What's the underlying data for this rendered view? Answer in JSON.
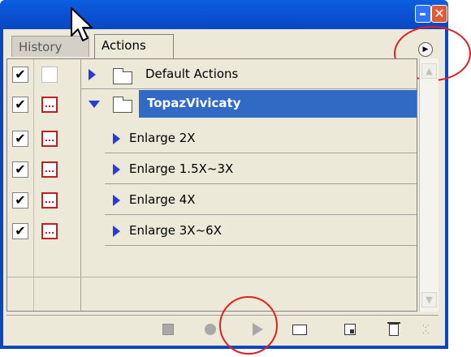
{
  "tabs": [
    {
      "label": "History",
      "active": false
    },
    {
      "label": "Actions",
      "active": true
    }
  ],
  "actions": {
    "set": [
      {
        "label": "Default Actions",
        "expanded": false,
        "checked": true,
        "dialog": false
      },
      {
        "label": "TopazVivicaty",
        "expanded": true,
        "selected": true,
        "checked": true,
        "dialog": true
      }
    ],
    "items": [
      {
        "label": "Enlarge 2X",
        "checked": true,
        "dialog": true
      },
      {
        "label": "Enlarge 1.5X~3X",
        "checked": true,
        "dialog": true
      },
      {
        "label": "Enlarge 4X",
        "checked": true,
        "dialog": true
      },
      {
        "label": "Enlarge 3X~6X",
        "checked": true,
        "dialog": true
      }
    ]
  },
  "checkmark": "✔",
  "toolbar": {
    "buttons": [
      "stop-icon",
      "record-icon",
      "play-icon",
      "new-set-icon",
      "new-action-icon",
      "trash-icon"
    ]
  },
  "colors": {
    "selection": "#316ac5",
    "annotation": "#e02020",
    "title_bar": "#0a5fe0"
  }
}
